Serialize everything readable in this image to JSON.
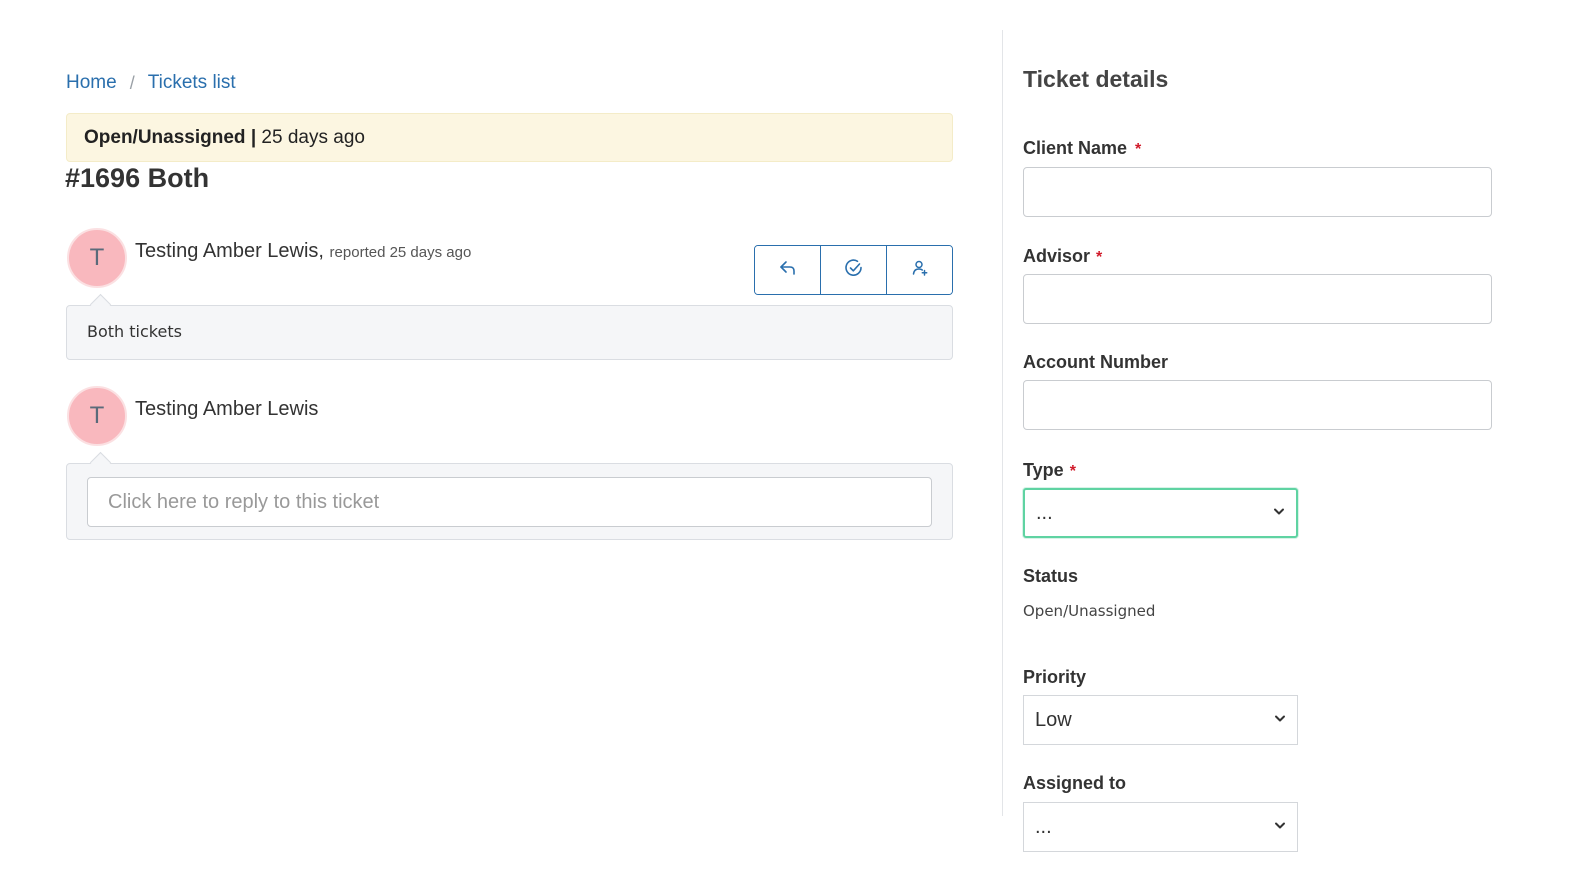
{
  "breadcrumb": {
    "items": [
      {
        "label": "Home"
      },
      {
        "label": "Tickets list"
      }
    ],
    "separator": "/"
  },
  "ticket": {
    "status_label": "Open/Unassigned",
    "status_separator": "|",
    "age": "25 days ago",
    "title": "#1696 Both"
  },
  "message": {
    "avatar_initial": "T",
    "author": "Testing Amber Lewis,",
    "meta": "reported 25 days ago",
    "body": "Both tickets"
  },
  "actions": [
    {
      "icon": "reply-icon"
    },
    {
      "icon": "check-circle-icon"
    },
    {
      "icon": "assign-user-icon"
    }
  ],
  "reply": {
    "avatar_initial": "T",
    "author": "Testing Amber Lewis",
    "placeholder": "Click here to reply to this ticket"
  },
  "details": {
    "title": "Ticket details",
    "client_name": {
      "label": "Client Name",
      "required_mark": "*",
      "value": ""
    },
    "advisor": {
      "label": "Advisor",
      "required_mark": "*",
      "value": ""
    },
    "account_number": {
      "label": "Account Number",
      "value": ""
    },
    "type": {
      "label": "Type",
      "required_mark": "*",
      "value": "..."
    },
    "status": {
      "label": "Status",
      "value": "Open/Unassigned"
    },
    "priority": {
      "label": "Priority",
      "value": "Low"
    },
    "assigned_to": {
      "label": "Assigned to",
      "value": "..."
    }
  },
  "colors": {
    "link": "#2a6fad",
    "banner_bg": "#fcf6e1",
    "avatar_bg": "#f9b8be",
    "required": "#d11a2a",
    "focus_border": "#5fd3a2"
  }
}
